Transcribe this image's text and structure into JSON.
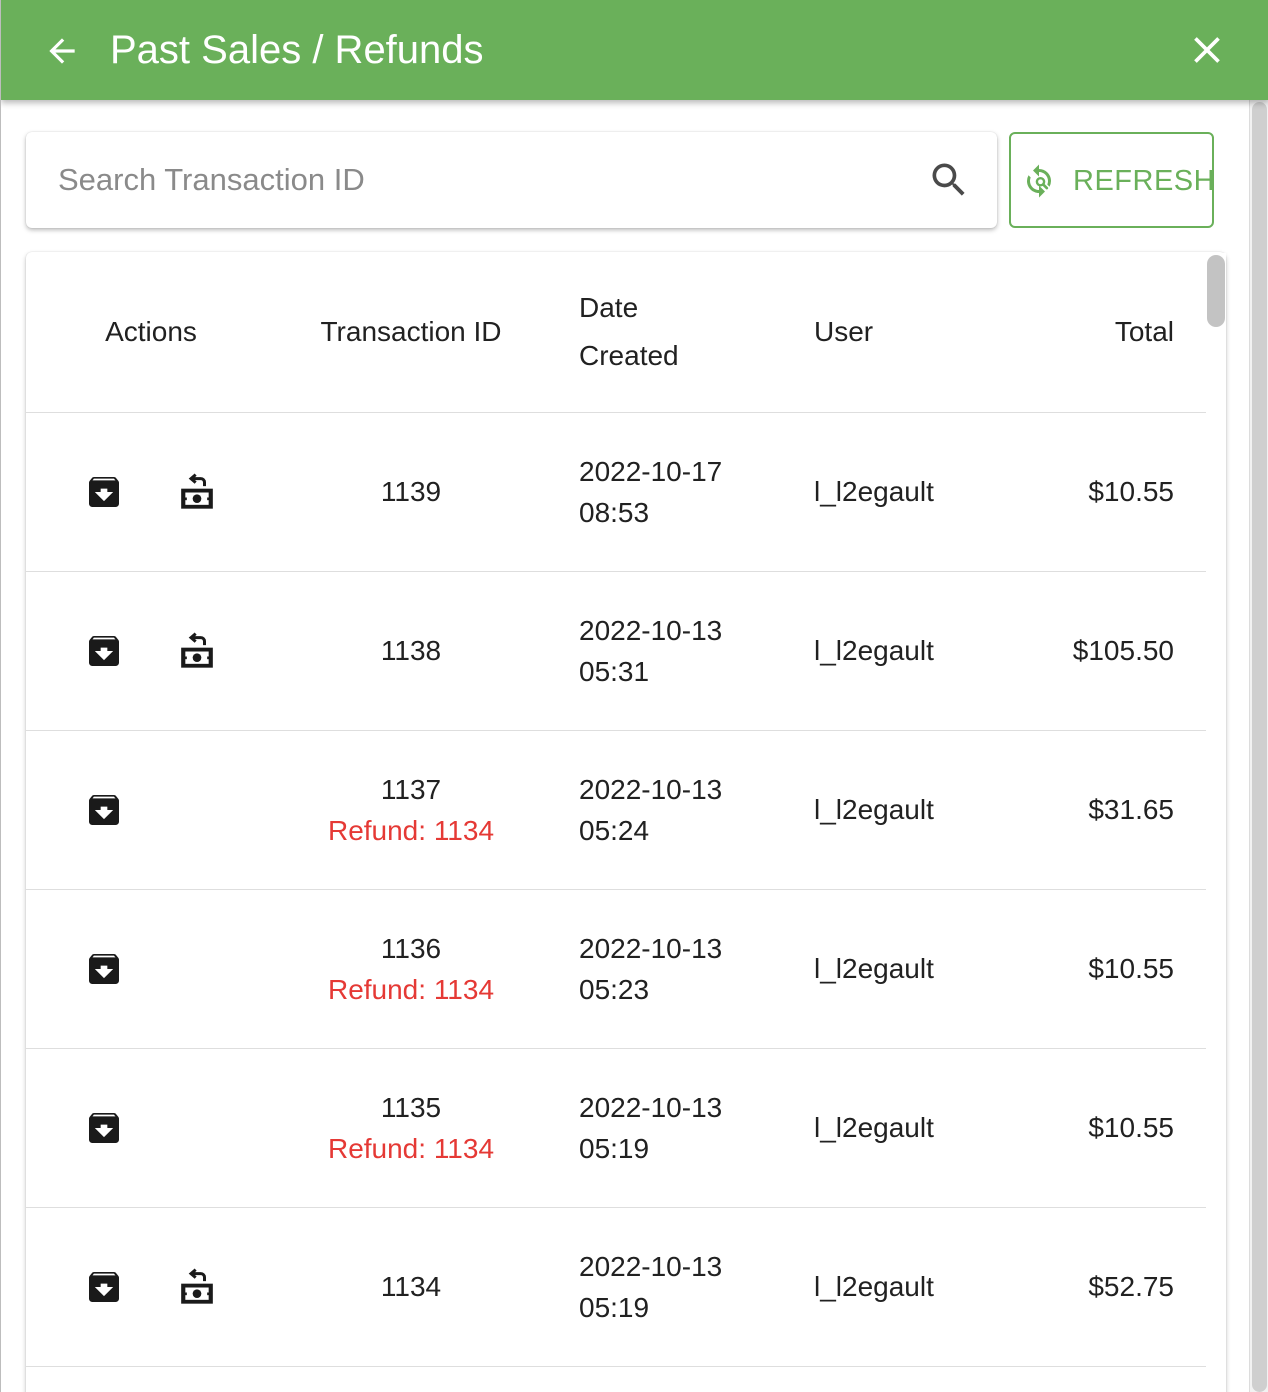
{
  "header": {
    "title": "Past Sales / Refunds",
    "back_icon": "arrow-left-icon",
    "close_icon": "close-icon",
    "background": "#6ab05a"
  },
  "search": {
    "placeholder": "Search Transaction ID",
    "value": "",
    "icon": "search-icon"
  },
  "refresh_button": {
    "label": "REFRESH",
    "icon": "refresh-icon",
    "color": "#6ab05a"
  },
  "table": {
    "columns": {
      "actions": "Actions",
      "transaction_id": "Transaction ID",
      "date_line1": "Date",
      "date_line2": "Created",
      "user": "User",
      "total": "Total"
    },
    "rows": [
      {
        "id": "1139",
        "refund": "",
        "date": "2022-10-17",
        "time": "08:53",
        "user": "l_l2egault",
        "total": "$10.55",
        "can_refund": true
      },
      {
        "id": "1138",
        "refund": "",
        "date": "2022-10-13",
        "time": "05:31",
        "user": "l_l2egault",
        "total": "$105.50",
        "can_refund": true
      },
      {
        "id": "1137",
        "refund": "Refund: 1134",
        "date": "2022-10-13",
        "time": "05:24",
        "user": "l_l2egault",
        "total": "$31.65",
        "can_refund": false
      },
      {
        "id": "1136",
        "refund": "Refund: 1134",
        "date": "2022-10-13",
        "time": "05:23",
        "user": "l_l2egault",
        "total": "$10.55",
        "can_refund": false
      },
      {
        "id": "1135",
        "refund": "Refund: 1134",
        "date": "2022-10-13",
        "time": "05:19",
        "user": "l_l2egault",
        "total": "$10.55",
        "can_refund": false
      },
      {
        "id": "1134",
        "refund": "",
        "date": "2022-10-13",
        "time": "05:19",
        "user": "l_l2egault",
        "total": "$52.75",
        "can_refund": true
      }
    ],
    "action_icons": {
      "archive": "archive-download-icon",
      "refund": "money-refund-icon"
    },
    "refund_color": "#e53935"
  }
}
